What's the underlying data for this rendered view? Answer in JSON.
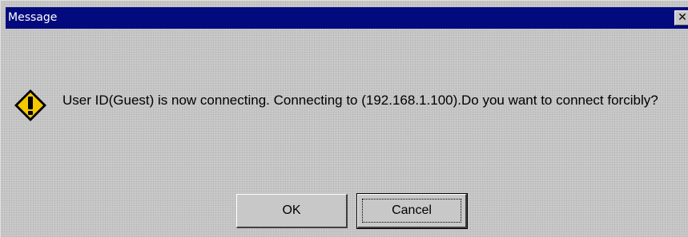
{
  "window": {
    "title": "Message",
    "close_label": "✕"
  },
  "dialog": {
    "icon": "warning-exclamation-icon",
    "message": "User ID(Guest) is now connecting. Connecting to (192.168.1.100).Do you want to connect forcibly?"
  },
  "buttons": {
    "ok_label": "OK",
    "cancel_label": "Cancel",
    "default": "Cancel"
  },
  "colors": {
    "title_bar": "#020a7e",
    "dialog_background": "#c4c4c4",
    "icon_fill": "#f5c800"
  }
}
